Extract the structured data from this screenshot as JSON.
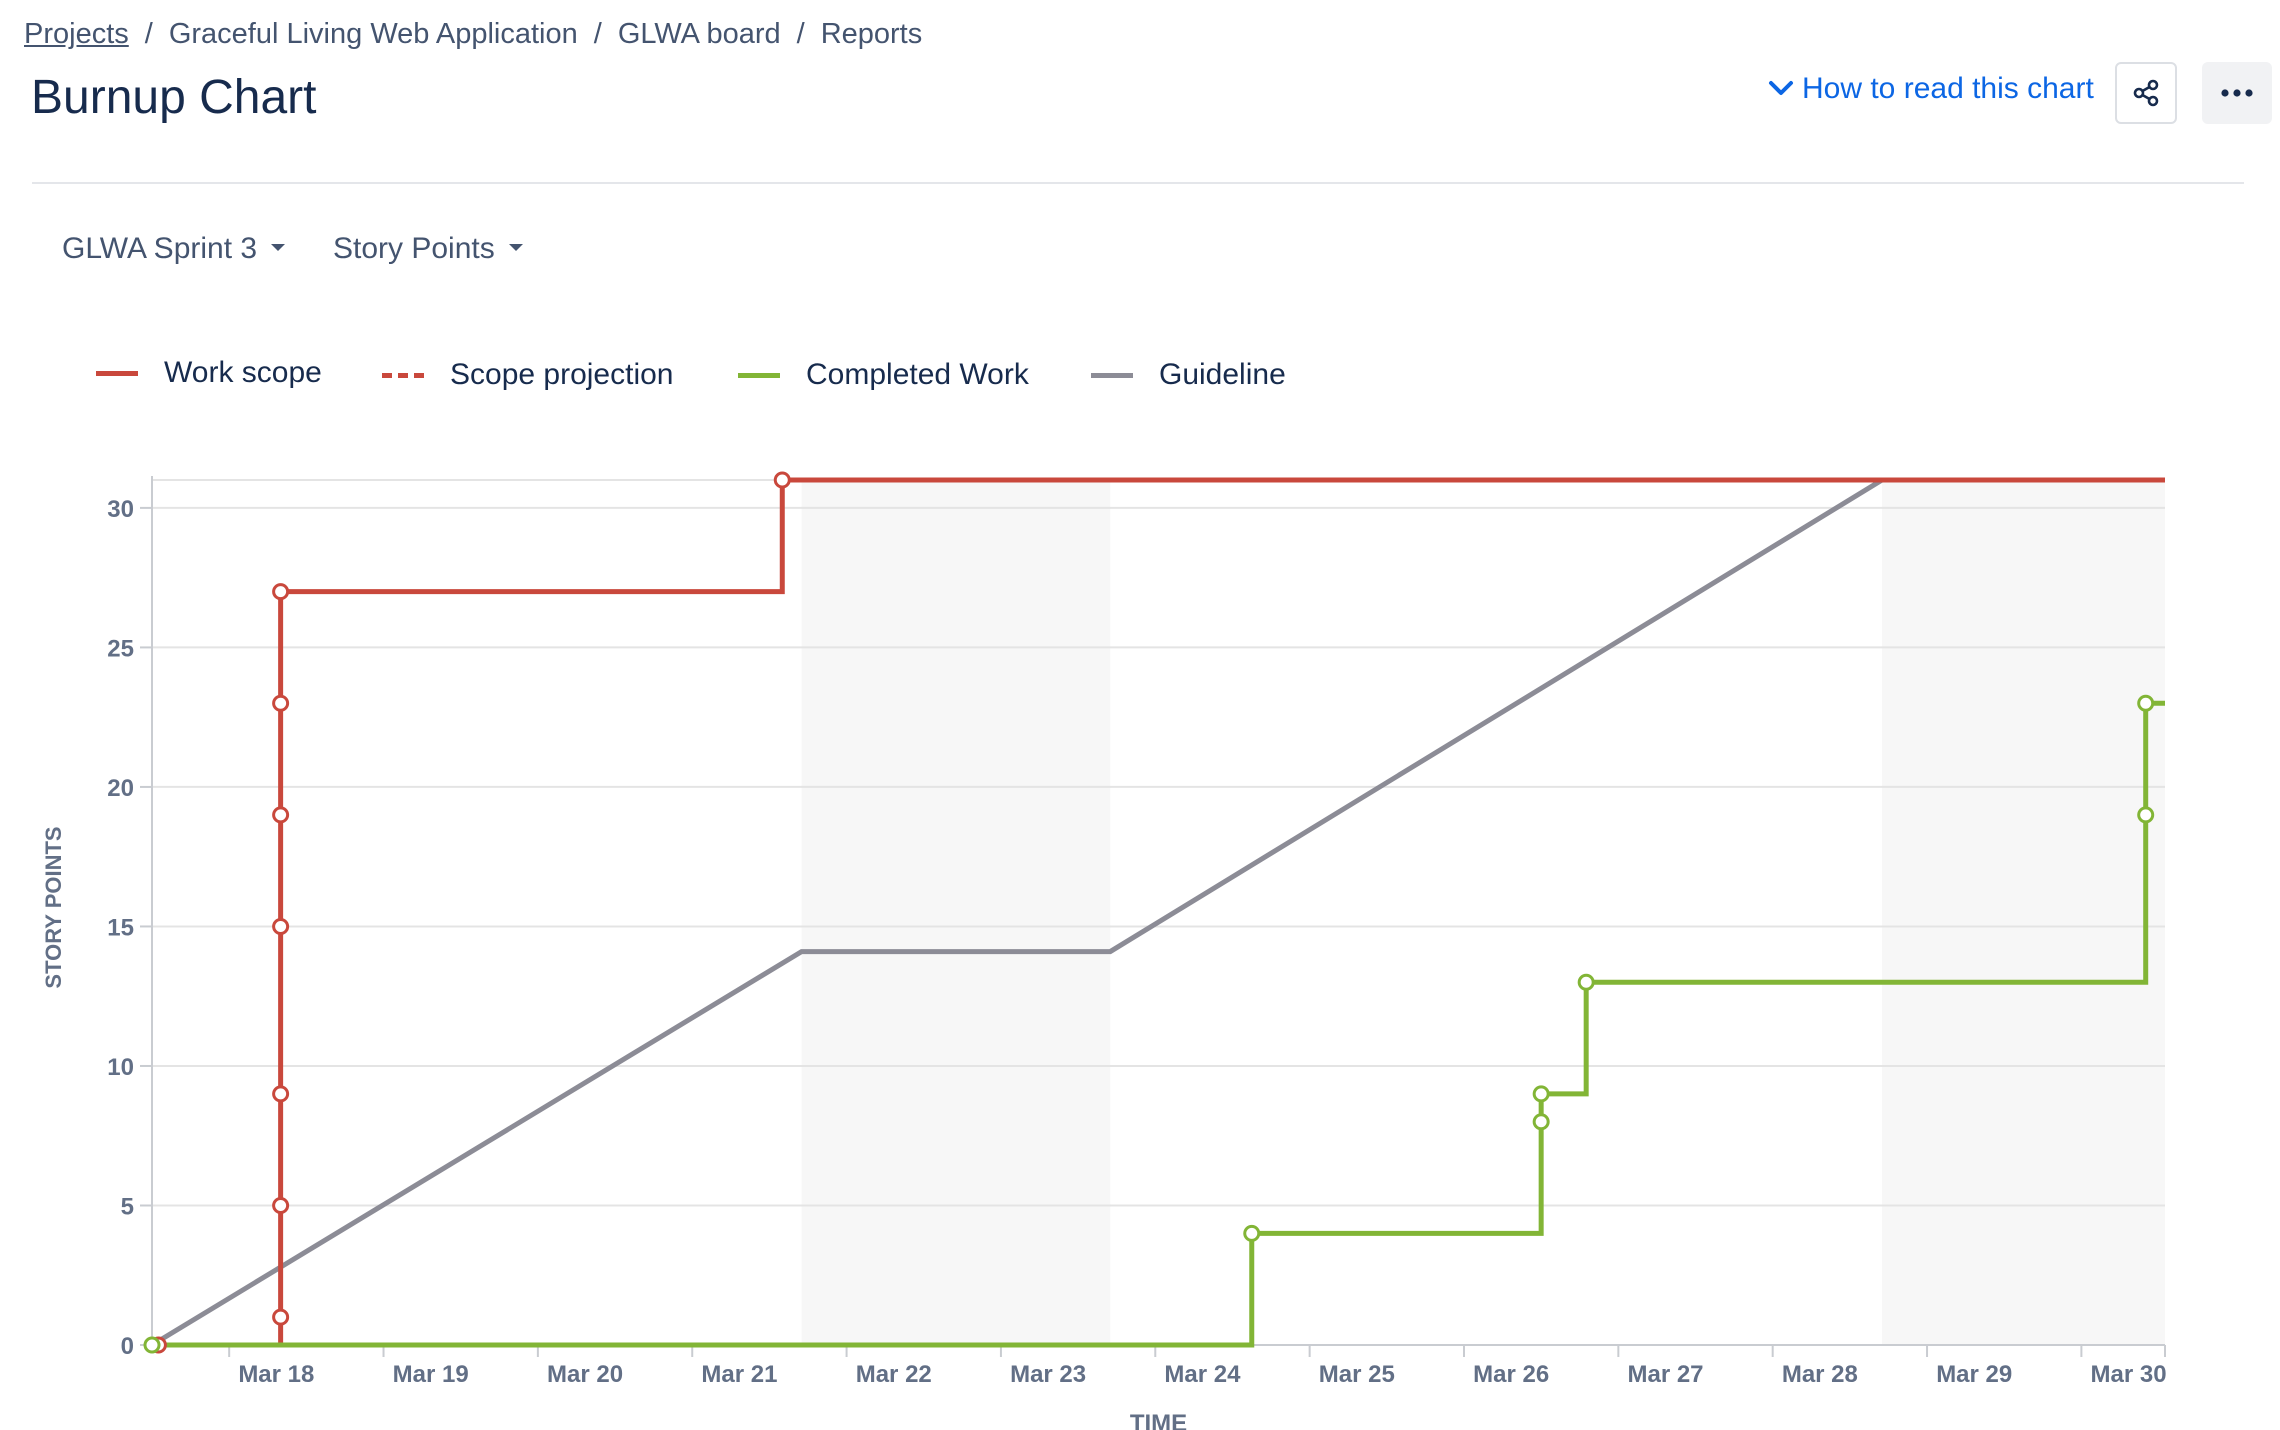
{
  "breadcrumb": {
    "items": [
      "Projects",
      "Graceful Living Web Application",
      "GLWA board",
      "Reports"
    ],
    "separator": "/"
  },
  "page": {
    "title": "Burnup Chart",
    "help_link": "How to read this chart"
  },
  "filters": {
    "sprint": "GLWA Sprint 3",
    "estimation": "Story Points"
  },
  "colors": {
    "work_scope": "#c9483c",
    "completed": "#82b536",
    "guideline": "#8c8c96",
    "link": "#0c66e4",
    "non_working": "#f7f7f7",
    "grid": "#e4e4e4"
  },
  "chart_data": {
    "type": "line",
    "xlabel": "TIME",
    "ylabel": "STORY POINTS",
    "ylim": [
      0,
      31
    ],
    "yticks": [
      0,
      5,
      10,
      15,
      20,
      25,
      30
    ],
    "x_tick_labels": [
      "Mar 18",
      "Mar 19",
      "Mar 20",
      "Mar 21",
      "Mar 22",
      "Mar 23",
      "Mar 24",
      "Mar 25",
      "Mar 26",
      "Mar 27",
      "Mar 28",
      "Mar 29",
      "Mar 30"
    ],
    "xlim": [
      "2024-03-17 12:00",
      "2024-03-30 13:00"
    ],
    "legend": {
      "position": "top-left"
    },
    "non_working_ranges": [
      [
        "2024-03-21 17:00",
        "2024-03-23 17:00"
      ],
      [
        "2024-03-28 17:00",
        "2024-03-30 13:00"
      ]
    ],
    "series": [
      {
        "name": "Work scope",
        "style": "step",
        "points": [
          {
            "x": "2024-03-17 13:00",
            "y": 0
          },
          {
            "x": "2024-03-18 08:00",
            "y": 1
          },
          {
            "x": "2024-03-18 08:00",
            "y": 5
          },
          {
            "x": "2024-03-18 08:00",
            "y": 9
          },
          {
            "x": "2024-03-18 08:00",
            "y": 15
          },
          {
            "x": "2024-03-18 08:00",
            "y": 19
          },
          {
            "x": "2024-03-18 08:00",
            "y": 23
          },
          {
            "x": "2024-03-18 08:00",
            "y": 27
          },
          {
            "x": "2024-03-21 14:00",
            "y": 31
          },
          {
            "x": "2024-03-30 13:00",
            "y": 31,
            "marker": false
          }
        ]
      },
      {
        "name": "Scope projection",
        "style": "dashed",
        "points": []
      },
      {
        "name": "Completed Work",
        "style": "step",
        "points": [
          {
            "x": "2024-03-17 12:00",
            "y": 0
          },
          {
            "x": "2024-03-24 15:00",
            "y": 4
          },
          {
            "x": "2024-03-26 12:00",
            "y": 8
          },
          {
            "x": "2024-03-26 12:00",
            "y": 9
          },
          {
            "x": "2024-03-26 19:00",
            "y": 13
          },
          {
            "x": "2024-03-30 10:00",
            "y": 19
          },
          {
            "x": "2024-03-30 10:00",
            "y": 23
          },
          {
            "x": "2024-03-30 13:00",
            "y": 23,
            "marker": false
          }
        ]
      },
      {
        "name": "Guideline",
        "style": "line",
        "points": [
          {
            "x": "2024-03-17 12:00",
            "y": 0
          },
          {
            "x": "2024-03-21 17:00",
            "y": 14.1
          },
          {
            "x": "2024-03-23 17:00",
            "y": 14.1
          },
          {
            "x": "2024-03-28 17:00",
            "y": 31
          },
          {
            "x": "2024-03-30 13:00",
            "y": 31
          }
        ]
      }
    ]
  }
}
